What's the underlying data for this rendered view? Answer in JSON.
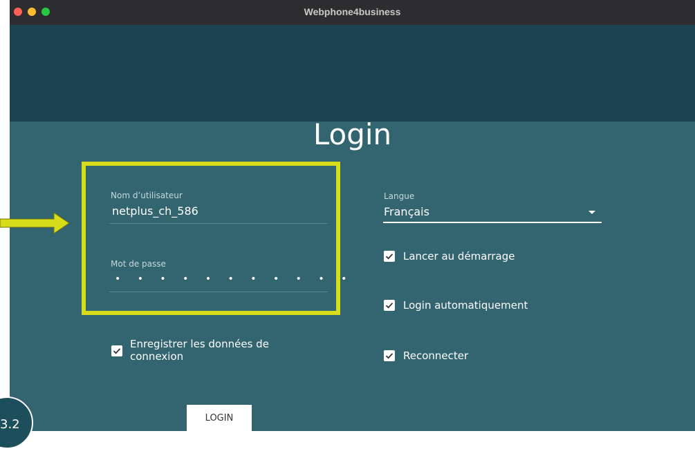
{
  "window": {
    "title": "Webphone4business"
  },
  "login": {
    "heading": "Login",
    "username": {
      "label": "Nom d’utilisateur",
      "value": "netplus_ch_586"
    },
    "password": {
      "label": "Mot de passe",
      "value": "• • • • • • • • • • •"
    },
    "save_credentials": {
      "label": "Enregistrer les données de connexion",
      "checked": true
    },
    "button": "LOGIN"
  },
  "settings": {
    "language": {
      "label": "Langue",
      "value": "Français"
    },
    "options": [
      {
        "label": "Lancer au démarrage",
        "checked": true
      },
      {
        "label": "Login automatiquement",
        "checked": true
      },
      {
        "label": "Reconnecter",
        "checked": true
      }
    ]
  },
  "annotation": {
    "step": "3.2",
    "highlight_color": "#d7dc1b",
    "arrow_color": "#d7dc1b"
  },
  "colors": {
    "header": "#1b4352",
    "background": "#336570"
  }
}
